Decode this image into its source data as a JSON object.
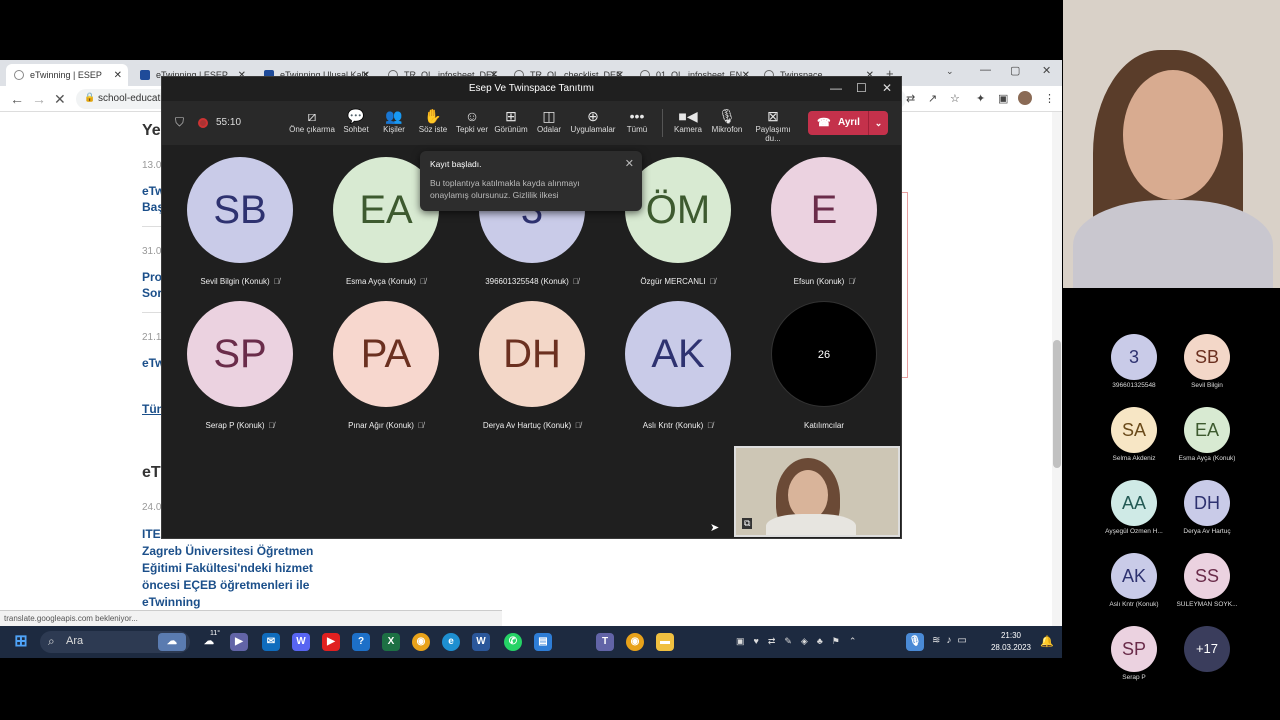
{
  "browser": {
    "tabs": [
      {
        "label": "eTwinning | ESEP",
        "active": true
      },
      {
        "label": "eTwinning | ESEP"
      },
      {
        "label": "eTwinning Ulusal Kalit"
      },
      {
        "label": "TR_OL_infosheet_DEF"
      },
      {
        "label": "TR_OL_checklist_DEF"
      },
      {
        "label": "01_OL_infosheet_EN"
      },
      {
        "label": "Twinspace"
      }
    ],
    "url": "school-educati",
    "status": "translate.googleapis.com bekleniyor..."
  },
  "page": {
    "heading1": "Ye",
    "date1": "13.0",
    "link1a": "eTw",
    "link1b": "Baş",
    "date2": "31.0",
    "link2a": "Pro",
    "link2b": "Sor",
    "date3": "21.1",
    "link3": "eTw",
    "all_link": "Tüm",
    "heading2": "eT",
    "date4": "24.0",
    "article_prefix": "ITE",
    "article_line1": "Zagreb Üniversitesi Öğretmen",
    "article_line2": "Eğitimi Fakültesi'ndeki hizmet",
    "article_line3": "öncesi EÇEB öğretmenleri ile",
    "article_line4": "eTwinning"
  },
  "taskbar": {
    "search": "Ara",
    "time": "21:30",
    "date": "28.03.2023",
    "weather": "11°"
  },
  "teams": {
    "title": "Esep Ve Twinspace Tanıtımı",
    "timer": "55:10",
    "tools": [
      {
        "label": "Öne çıkarma",
        "icon": "spotlight-icon"
      },
      {
        "label": "Sohbet",
        "icon": "chat-icon"
      },
      {
        "label": "Kişiler",
        "icon": "people-icon"
      },
      {
        "label": "Söz iste",
        "icon": "raise-hand-icon"
      },
      {
        "label": "Tepki ver",
        "icon": "reaction-icon"
      },
      {
        "label": "Görünüm",
        "icon": "view-icon"
      },
      {
        "label": "Odalar",
        "icon": "rooms-icon"
      },
      {
        "label": "Uygulamalar",
        "icon": "apps-icon"
      },
      {
        "label": "Tümü",
        "icon": "more-icon"
      },
      {
        "label": "Kamera",
        "icon": "camera-icon"
      },
      {
        "label": "Mikrofon",
        "icon": "microphone-icon"
      },
      {
        "label": "Paylaşımı du...",
        "icon": "stop-share-icon"
      }
    ],
    "leave_label": "Ayrıl",
    "toast": {
      "title": "Kayıt başladı.",
      "body_line1": "Bu toplantıya katılmakla kayda alınmayı",
      "body_line2": "onaylamış olursunuz. Gizlilik ilkesi"
    },
    "participants": [
      {
        "initials": "SB",
        "name": "Sevil Bilgin (Konuk)",
        "bg": "#c9cbe8",
        "fg": "#2e3270"
      },
      {
        "initials": "EA",
        "name": "Esma Ayça (Konuk)",
        "bg": "#d8ead2",
        "fg": "#3d5a2f"
      },
      {
        "initials": "3",
        "name": "396601325548 (Konuk)",
        "bg": "#c9cbe8",
        "fg": "#2e3270"
      },
      {
        "initials": "ÖM",
        "name": "Özgür MERCANLI",
        "bg": "#d8ead2",
        "fg": "#3d5a2f"
      },
      {
        "initials": "E",
        "name": "Efsun (Konuk)",
        "bg": "#ebd2e0",
        "fg": "#6a2c4a"
      },
      {
        "initials": "SP",
        "name": "Serap P (Konuk)",
        "bg": "#ebd2e0",
        "fg": "#6a2c4a"
      },
      {
        "initials": "PA",
        "name": "Pınar Ağır (Konuk)",
        "bg": "#f7d7ce",
        "fg": "#6b3020"
      },
      {
        "initials": "DH",
        "name": "Derya Av Hartuç (Konuk)",
        "bg": "#f3d7c8",
        "fg": "#6b3020"
      },
      {
        "initials": "AK",
        "name": "Aslı Kntr (Konuk)",
        "bg": "#c9cbe8",
        "fg": "#2e3270"
      },
      {
        "initials": "26",
        "name": "Katılımcılar",
        "bg": "#000000",
        "fg": "#ffffff"
      }
    ]
  },
  "side_panel": {
    "participants": [
      {
        "initials": "3",
        "name": "396601325548",
        "bg": "#c9cbe8",
        "fg": "#2e3270"
      },
      {
        "initials": "SB",
        "name": "Sevil Bilgin",
        "bg": "#f3d7c8",
        "fg": "#6b3020"
      },
      {
        "initials": "SA",
        "name": "Selma Akdeniz",
        "bg": "#f7e6c5",
        "fg": "#6a4a1a"
      },
      {
        "initials": "EA",
        "name": "Esma Ayça (Konuk)",
        "bg": "#d8ead2",
        "fg": "#3d5a2f"
      },
      {
        "initials": "AA",
        "name": "Ayşegül Özmen H...",
        "bg": "#cfeae6",
        "fg": "#235a54"
      },
      {
        "initials": "DH",
        "name": "Derya Av Hartuç",
        "bg": "#c9cbe8",
        "fg": "#2e3270"
      },
      {
        "initials": "AK",
        "name": "Aslı Kntr (Konuk)",
        "bg": "#c9cbe8",
        "fg": "#2e3270"
      },
      {
        "initials": "SS",
        "name": "SÜLEYMAN SOYK...",
        "bg": "#ebd2e0",
        "fg": "#6a2c4a"
      },
      {
        "initials": "SP",
        "name": "Serap P",
        "bg": "#ebd2e0",
        "fg": "#6a2c4a"
      },
      {
        "initials": "+17",
        "name": "",
        "bg": "#3a3d5c",
        "fg": "#ffffff"
      }
    ]
  }
}
